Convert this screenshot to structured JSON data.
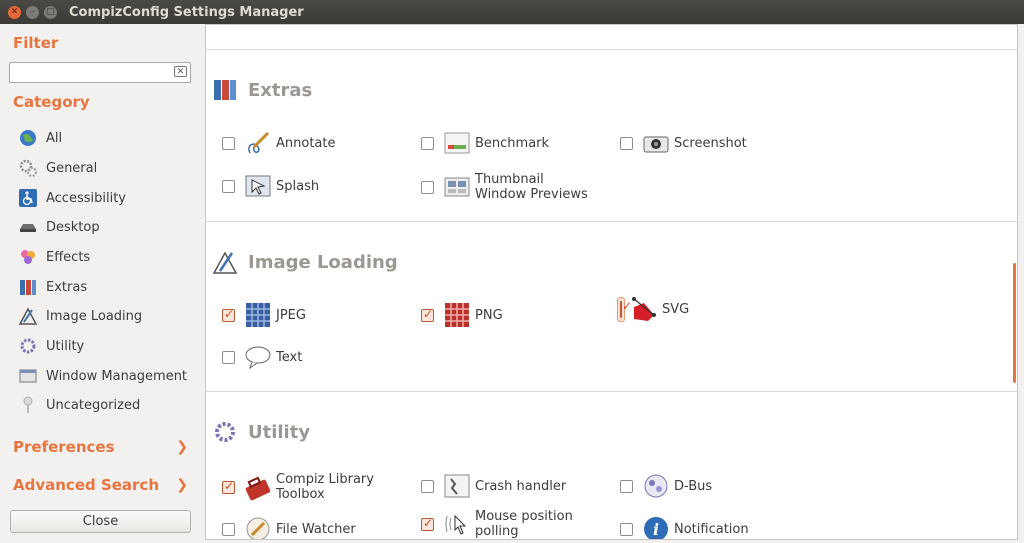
{
  "window": {
    "title": "CompizConfig Settings Manager"
  },
  "sidebar": {
    "filter_heading": "Filter",
    "filter_value": "",
    "category_heading": "Category",
    "categories": [
      {
        "label": "All",
        "icon": "globe-icon"
      },
      {
        "label": "General",
        "icon": "gears-icon"
      },
      {
        "label": "Accessibility",
        "icon": "wheelchair-icon"
      },
      {
        "label": "Desktop",
        "icon": "desktop-icon"
      },
      {
        "label": "Effects",
        "icon": "sparkle-icon"
      },
      {
        "label": "Extras",
        "icon": "books-icon"
      },
      {
        "label": "Image Loading",
        "icon": "paint-icon"
      },
      {
        "label": "Utility",
        "icon": "gear-icon"
      },
      {
        "label": "Window Management",
        "icon": "windows-icon"
      },
      {
        "label": "Uncategorized",
        "icon": "pin-icon"
      }
    ],
    "preferences_label": "Preferences",
    "advanced_search_label": "Advanced Search",
    "close_label": "Close"
  },
  "sections": {
    "extras": {
      "title": "Extras",
      "plugins": [
        {
          "label": "Annotate",
          "checked": false
        },
        {
          "label": "Benchmark",
          "checked": false
        },
        {
          "label": "Screenshot",
          "checked": false
        },
        {
          "label": "Splash",
          "checked": false
        },
        {
          "label_line1": "Thumbnail",
          "label_line2": "Window Previews",
          "checked": false
        }
      ]
    },
    "image_loading": {
      "title": "Image Loading",
      "plugins": [
        {
          "label": "JPEG",
          "checked": true
        },
        {
          "label": "PNG",
          "checked": true
        },
        {
          "label": "SVG",
          "checked": true
        },
        {
          "label": "Text",
          "checked": false
        }
      ]
    },
    "utility": {
      "title": "Utility",
      "plugins": [
        {
          "label_line1": "Compiz Library",
          "label_line2": "Toolbox",
          "checked": true
        },
        {
          "label": "Crash handler",
          "checked": false
        },
        {
          "label": "D-Bus",
          "checked": false
        },
        {
          "label": "File Watcher",
          "checked": false
        },
        {
          "label_line1": "Mouse position",
          "label_line2": "polling",
          "checked": true
        },
        {
          "label": "Notification",
          "checked": false
        }
      ]
    }
  },
  "colors": {
    "accent": "#e8753f",
    "titlebar": "#3b3a36"
  }
}
